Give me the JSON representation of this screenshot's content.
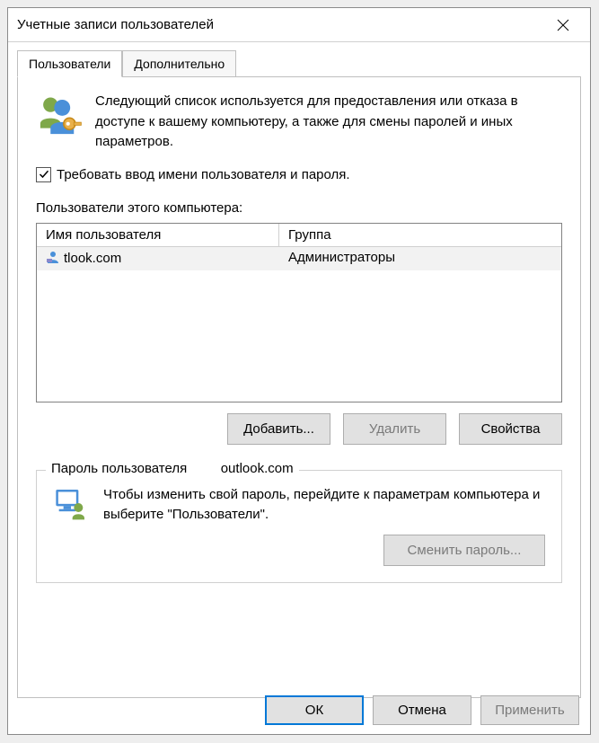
{
  "window": {
    "title": "Учетные записи пользователей"
  },
  "tabs": {
    "users": "Пользователи",
    "advanced": "Дополнительно"
  },
  "intro": {
    "text": "Следующий список используется для предоставления или отказа в доступе к вашему компьютеру, а также для смены паролей и иных параметров."
  },
  "checkbox": {
    "checked": true,
    "label": "Требовать ввод имени пользователя и пароля."
  },
  "list": {
    "label": "Пользователи этого компьютера:",
    "headers": {
      "name": "Имя пользователя",
      "group": "Группа"
    },
    "rows": [
      {
        "name": "tlook.com",
        "group": "Администраторы"
      }
    ]
  },
  "buttons": {
    "add": "Добавить...",
    "remove": "Удалить",
    "properties": "Свойства"
  },
  "password_group": {
    "legend_prefix": "Пароль пользователя",
    "legend_user": "outlook.com",
    "text": "Чтобы изменить свой пароль, перейдите к параметрам компьютера и выберите \"Пользователи\".",
    "change": "Сменить пароль..."
  },
  "footer": {
    "ok": "ОК",
    "cancel": "Отмена",
    "apply": "Применить"
  }
}
